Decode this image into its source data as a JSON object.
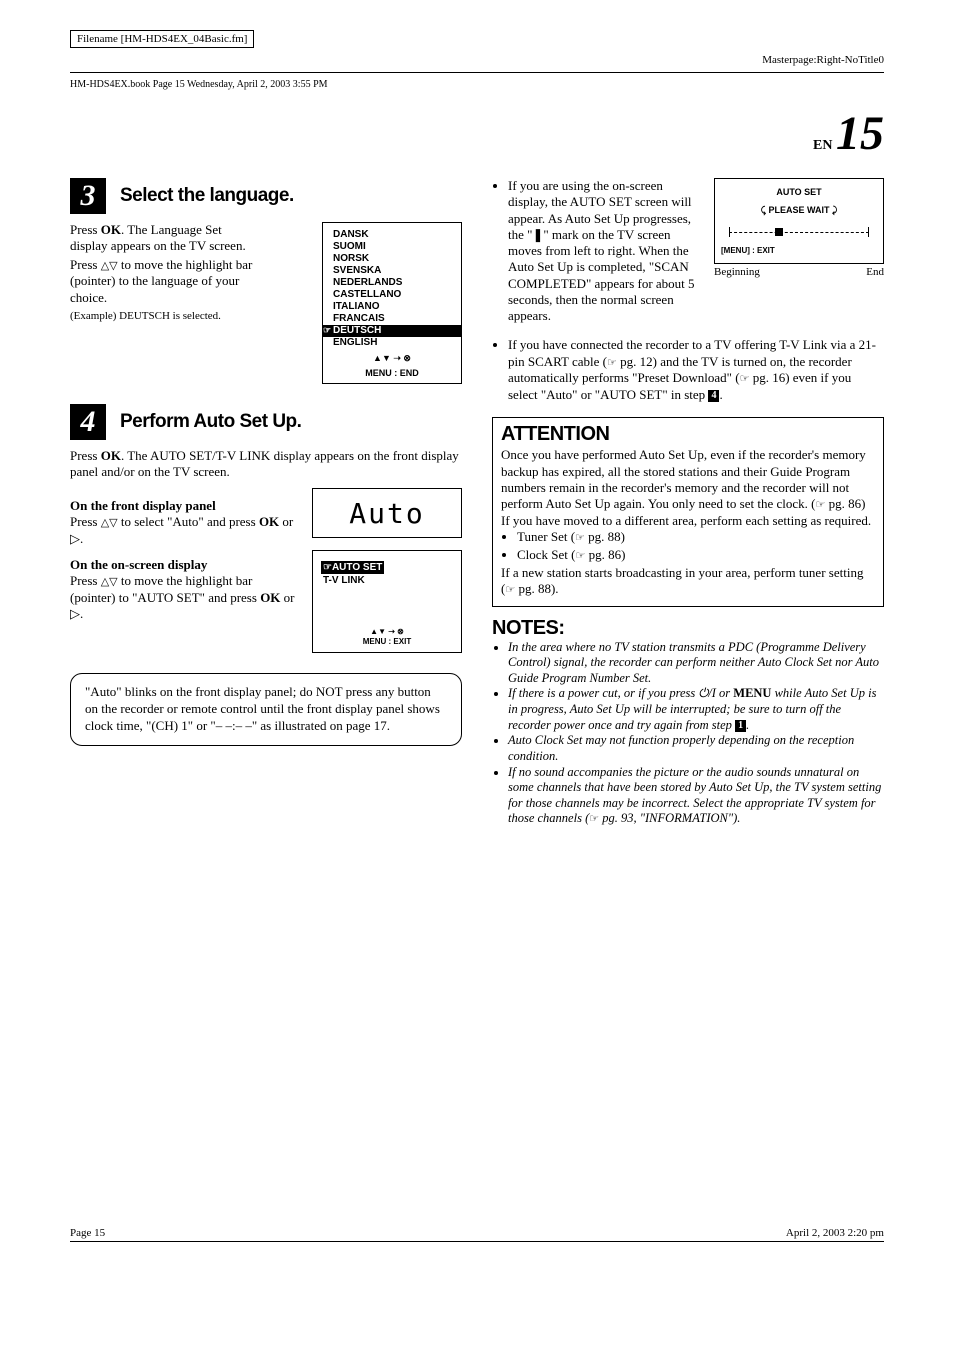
{
  "header": {
    "filename_label": "Filename [HM-HDS4EX_04Basic.fm]",
    "masterpage": "Masterpage:Right-NoTitle0",
    "bookinfo": "HM-HDS4EX.book  Page 15  Wednesday, April 2, 2003  3:55 PM"
  },
  "title": {
    "lang_code": "EN",
    "page_num": "15"
  },
  "step3": {
    "num": "3",
    "title": "Select the language.",
    "p1a": "Press ",
    "p1b": "OK",
    "p1c": ". The Language Set display appears on the TV screen.",
    "p2a": "Press ",
    "p2b": " to move the highlight bar (pointer) to the language of your choice.",
    "example": "(Example) DEUTSCH is selected.",
    "lang_list": [
      "DANSK",
      "SUOMI",
      "NORSK",
      "SVENSKA",
      "NEDERLANDS",
      "CASTELLANO",
      "ITALIANO",
      "FRANCAIS"
    ],
    "lang_selected": "DEUTSCH",
    "lang_after": "ENGLISH",
    "lang_footer1": "▲▼ ➝ ⊗",
    "lang_footer2": "MENU : END"
  },
  "step4": {
    "num": "4",
    "title": "Perform Auto Set Up.",
    "p1a": "Press ",
    "p1b": "OK",
    "p1c": ". The AUTO SET/T-V LINK display appears on the front display panel and/or on the TV screen.",
    "sub1": "On the front display panel",
    "sub1a": "Press ",
    "sub1b": " to select \"Auto\" and press ",
    "sub1c": "OK",
    "sub1d": " or ▷.",
    "sub2": "On the on-screen display",
    "sub2a": "Press ",
    "sub2b": " to move the highlight bar (pointer) to \"AUTO SET\" and press ",
    "sub2c": "OK",
    "sub2d": " or ▷.",
    "display_text": "Auto",
    "onscreen_sel": "☞AUTO SET",
    "onscreen_row": "T-V LINK",
    "onscreen_f1": "▲▼ ➝ ⊗",
    "onscreen_f2": "MENU : EXIT",
    "note_box": "\"Auto\" blinks on the front display panel; do NOT press any button on the recorder or remote control until the front display panel shows clock time, \"(CH) 1\" or \"– –:– –\" as illustrated on page 17."
  },
  "right": {
    "p1": "If you are using the on-screen display, the AUTO SET screen will appear. As Auto Set Up progresses, the \"❚\" mark on the TV screen moves from left to right. When the Auto Set Up is completed, \"SCAN COMPLETED\" appears for about 5 seconds, then the normal screen appears.",
    "progress_title": "AUTO SET",
    "progress_wait": "⤹ PLEASE WAIT ⤸",
    "progress_menu": "[MENU] : EXIT",
    "beginning": "Beginning",
    "end": "End",
    "p2a": "If you have connected the recorder to a TV offering T-V Link via a 21-pin SCART cable (",
    "p2b": " pg. 12) and the TV is turned on, the recorder automatically performs \"Preset Download\" (",
    "p2c": " pg. 16) even if you select \"Auto\" or \"AUTO SET\" in step ",
    "p2d": ".",
    "step_ref": "4"
  },
  "attention": {
    "title": "ATTENTION",
    "p1a": "Once you have performed Auto Set Up, even if the recorder's memory backup has expired, all the stored stations and their Guide Program numbers remain in the recorder's memory and the recorder will not perform Auto Set Up again. You only need to set the clock. (",
    "p1b": " pg. 86)",
    "p2": "If you have moved to a different area, perform each setting as required.",
    "b1a": "Tuner Set (",
    "b1b": " pg. 88)",
    "b2a": "Clock Set (",
    "b2b": " pg. 86)",
    "p3a": "If a new station starts broadcasting in your area, perform tuner setting (",
    "p3b": " pg. 88)."
  },
  "notes": {
    "title": "NOTES:",
    "n1": "In the area where no TV station transmits a PDC (Programme Delivery Control) signal, the recorder can perform neither Auto Clock Set nor Auto Guide Program Number Set.",
    "n2a": "If there is a power cut, or if you press ⏻/I or ",
    "n2b": "MENU",
    "n2c": " while Auto Set Up is in progress, Auto Set Up will be interrupted; be sure to turn off the recorder power once and try again from step ",
    "n2d": ".",
    "n2_ref": "1",
    "n3": "Auto Clock Set may not function properly depending on the reception condition.",
    "n4a": "If no sound accompanies the picture or the audio sounds unnatural on some channels that have been stored by Auto Set Up, the TV system setting for those channels may be incorrect. Select the appropriate TV system for those channels (",
    "n4b": " pg. 93, \"INFORMATION\")."
  },
  "footer": {
    "page_label": "Page 15",
    "timestamp": "April 2, 2003  2:20 pm"
  },
  "glyphs": {
    "updown": "△▽",
    "pageref": "☞"
  }
}
